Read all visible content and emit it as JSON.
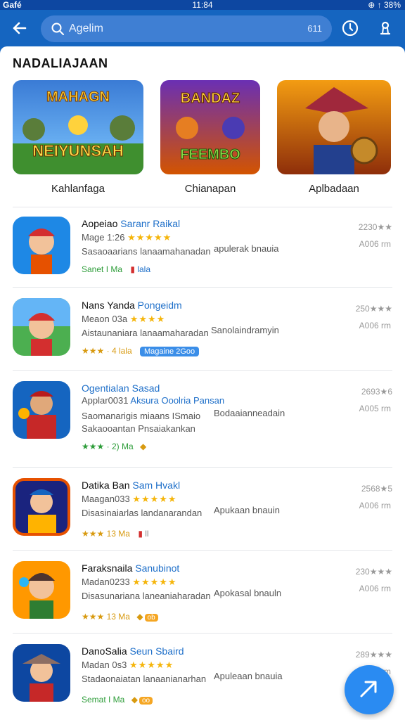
{
  "status_bar": {
    "carrier": "Gafé",
    "time": "11:84",
    "indicators": "⊕ ↑ 38%"
  },
  "app_bar": {
    "back_icon": "arrow-left-icon",
    "search_text": "Agelim",
    "search_count": "611",
    "history_icon": "clock-icon",
    "profile_icon": "profile-icon"
  },
  "featured": {
    "title": "NADALIAJAAN",
    "items": [
      {
        "label": "Kahlanfaga",
        "art_title": "MAHAGN",
        "art_subtitle": "NEIYUNSAH"
      },
      {
        "label": "Chianapan",
        "art_title": "BANDAZ",
        "art_subtitle": "FEEMBO"
      },
      {
        "label": "Aplbadaan",
        "art_title": "",
        "art_subtitle": ""
      }
    ]
  },
  "apps": [
    {
      "title": "Aopeiao",
      "title_sub": "Saranr Raikal",
      "meta": "Mage 1:26",
      "stars": "★★★★★",
      "desc": "Sasaoaarians lanaamahanadan",
      "side": "apulerak bnauia",
      "tag1": "Sanet I Ma",
      "tag2": "lala",
      "rating": "2230★★",
      "size": "A006 rm"
    },
    {
      "title": "Nans Yanda",
      "title_sub": "Pongeidm",
      "meta": "Meaon 03a",
      "stars": "★★★★",
      "desc": "Aistaunaniara lanaamaharadan",
      "side": "Sanolaindramyin",
      "tag1": "★★★ · 4 lala",
      "badge": "Magaine 2Goo",
      "rating": "250★★★",
      "size": "A006 rm"
    },
    {
      "title": "Ogentialan",
      "title_sub": "Sasad",
      "meta": "Applar0031",
      "meta_sub": "Aksura Ooolria Pansan",
      "desc": "Saomanarigis miaans ISmaio",
      "desc2": "Sakaooantan Pnsaiakankan",
      "side": "Bodaaianneadain",
      "tag1": "★★★ · 2) Ma",
      "rating": "2693★6",
      "size": "A005 rm"
    },
    {
      "title": "Datika Ban",
      "title_sub": "Sam Hvakl",
      "meta": "Maagan033",
      "stars": "★★★★★",
      "desc": "Disasinaiarlas landanarandan",
      "side": "Apukaan bnauin",
      "tag1": "★★★ 13 Ma",
      "tag2": "ll",
      "rating": "2568★5",
      "size": "A006 rm"
    },
    {
      "title": "Faraksnaila",
      "title_sub": "Sanubinot",
      "meta": "Madan0233",
      "stars": "★★★★★",
      "desc": "Disasunariana laneaniaharadan",
      "side": "Apokasal bnauln",
      "tag1": "★★★ 13 Ma",
      "badge": "ob",
      "rating": "230★★★",
      "size": "A006 rm"
    },
    {
      "title": "DanoSalia",
      "title_sub": "Seun Sbaird",
      "meta": "Madan 0s3",
      "stars": "★★★★★",
      "desc": "Stadaonaiatan lanaanianarhan",
      "side": "Apuleaan bnauia",
      "tag1": "Semat I Ma",
      "badge": "oo",
      "rating": "289★★★",
      "size": "A066 rm"
    }
  ],
  "fab_icon": "chevron-right-icon"
}
